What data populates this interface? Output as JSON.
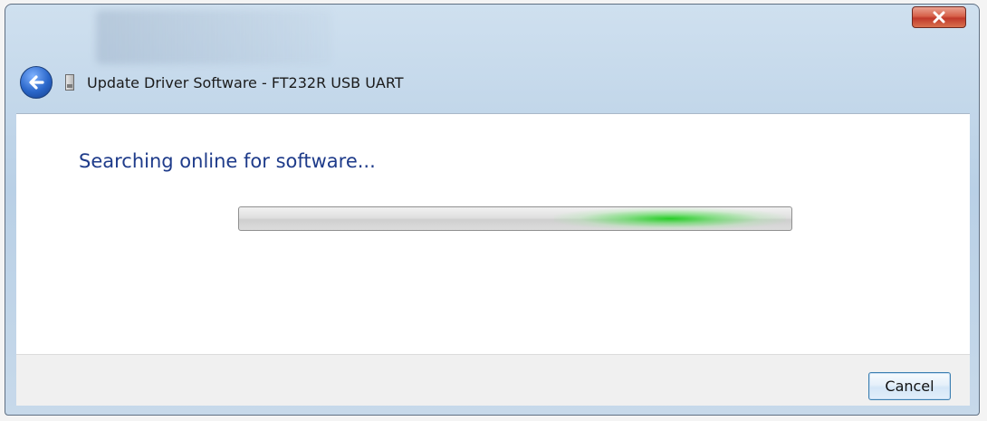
{
  "window": {
    "title": "Update Driver Software - FT232R USB UART"
  },
  "content": {
    "heading": "Searching online for software..."
  },
  "progress": {
    "mode": "indeterminate",
    "fill_color": "#1ccd1c",
    "marquee_position": 0.78
  },
  "footer": {
    "cancel_label": "Cancel"
  },
  "icons": {
    "close": "close-icon",
    "back": "back-arrow-icon",
    "device": "usb-device-icon"
  },
  "colors": {
    "heading": "#1e3b8a",
    "close_button": "#c0392b",
    "back_button": "#2a66c9"
  }
}
